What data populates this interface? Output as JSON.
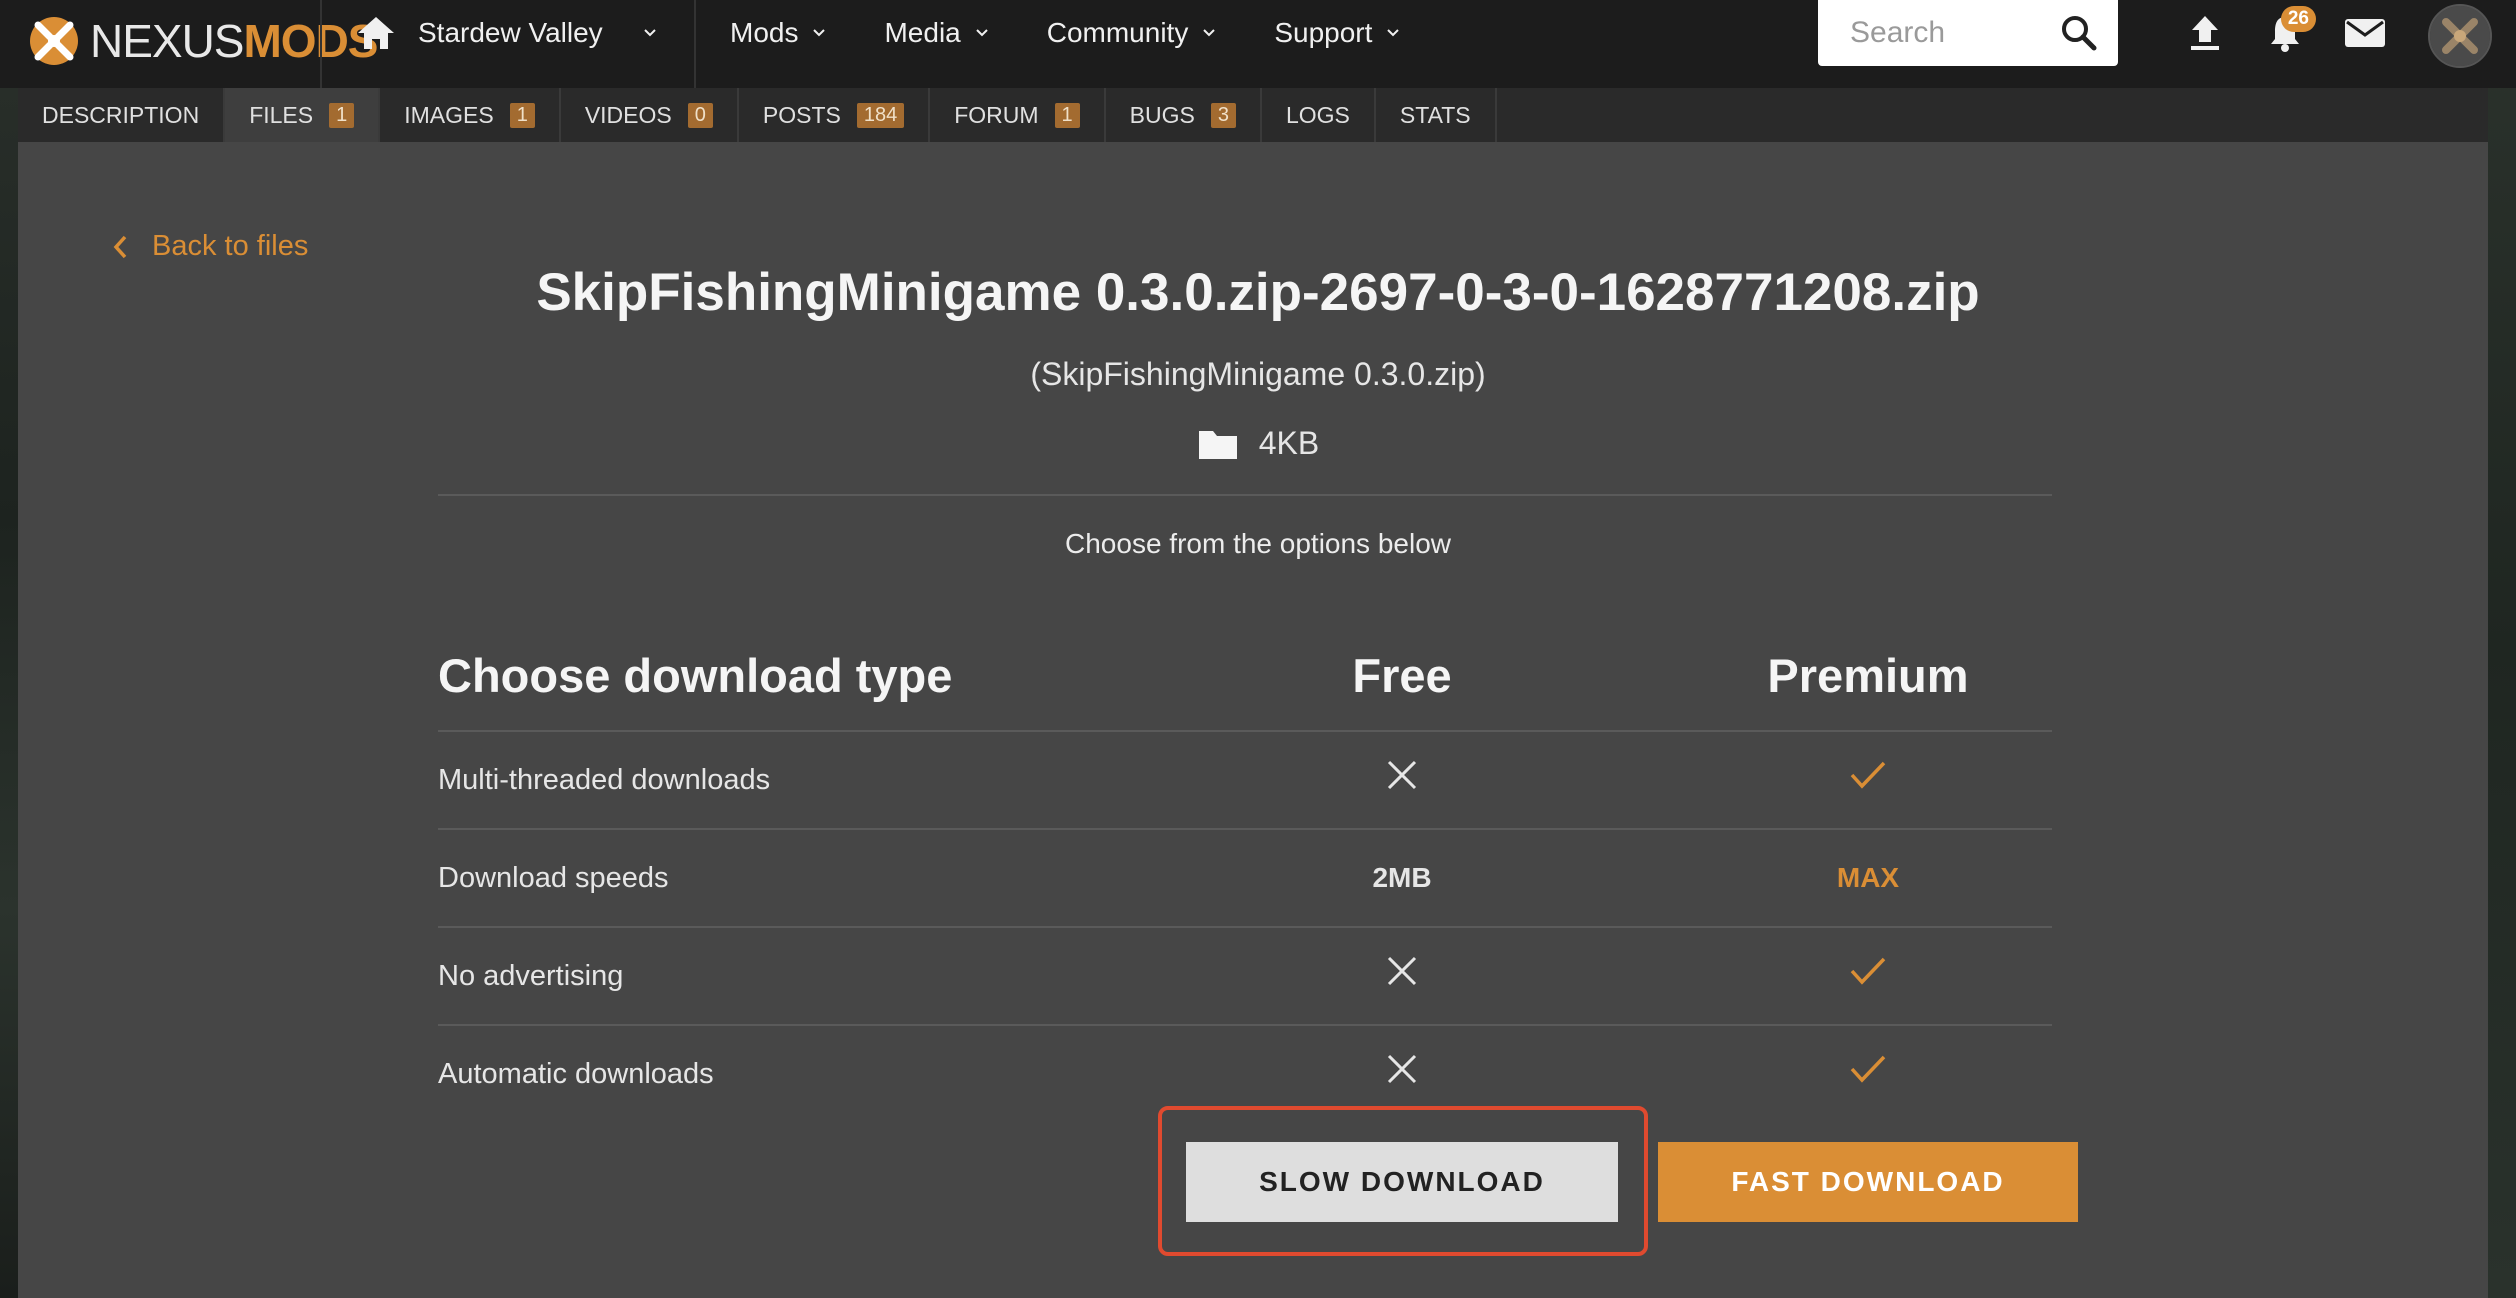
{
  "nav": {
    "logo_part1": "NEXUS",
    "logo_part2": "MODS",
    "game": "Stardew Valley",
    "menu": [
      "Mods",
      "Media",
      "Community",
      "Support"
    ],
    "search_placeholder": "Search",
    "notifications_count": "26"
  },
  "tabs": [
    {
      "label": "DESCRIPTION",
      "count": ""
    },
    {
      "label": "FILES",
      "count": "1"
    },
    {
      "label": "IMAGES",
      "count": "1"
    },
    {
      "label": "VIDEOS",
      "count": "0"
    },
    {
      "label": "POSTS",
      "count": "184"
    },
    {
      "label": "FORUM",
      "count": "1"
    },
    {
      "label": "BUGS",
      "count": "3"
    },
    {
      "label": "LOGS",
      "count": ""
    },
    {
      "label": "STATS",
      "count": ""
    }
  ],
  "back_label": "Back to files",
  "file": {
    "title": "SkipFishingMinigame 0.3.0.zip-2697-0-3-0-1628771208.zip",
    "subtitle": "(SkipFishingMinigame 0.3.0.zip)",
    "size": "4KB"
  },
  "choose_options": "Choose from the options below",
  "table": {
    "header": "Choose download type",
    "free_header": "Free",
    "premium_header": "Premium",
    "rows": [
      {
        "label": "Multi-threaded downloads",
        "free": "",
        "premium": ""
      },
      {
        "label": "Download speeds",
        "free": "2MB",
        "premium": "MAX"
      },
      {
        "label": "No advertising",
        "free": "",
        "premium": ""
      },
      {
        "label": "Automatic downloads",
        "free": "",
        "premium": ""
      }
    ]
  },
  "buttons": {
    "slow": "SLOW DOWNLOAD",
    "fast": "FAST DOWNLOAD"
  },
  "colors": {
    "accent": "#da8e35",
    "highlight": "#e04a2f"
  }
}
